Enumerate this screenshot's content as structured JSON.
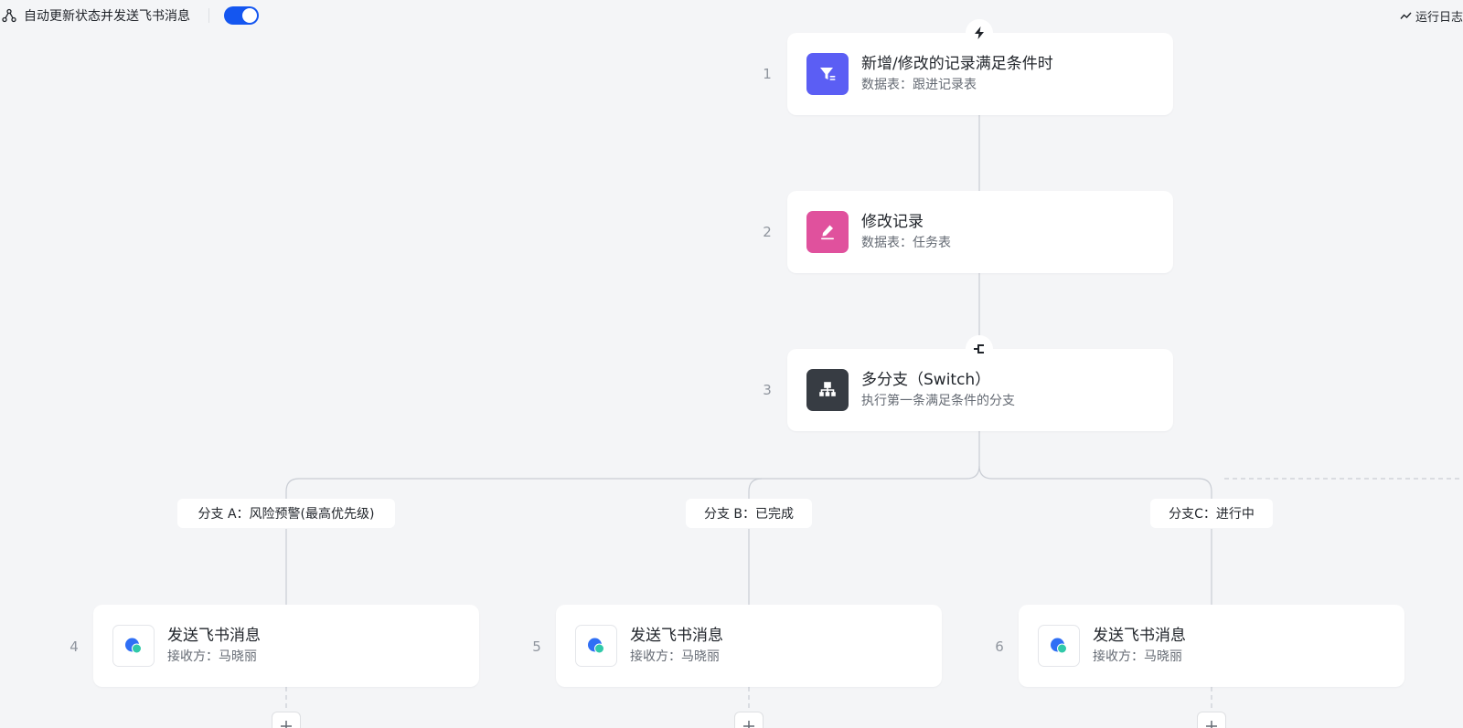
{
  "header": {
    "workflow_name": "自动更新状态并发送飞书消息",
    "enabled": true,
    "run_log_label": "运行日志"
  },
  "colors": {
    "accent": "#1456f0",
    "trigger_icon_bg": "#5b5ef4",
    "update_icon_bg": "#e0519d",
    "switch_icon_bg": "#373c43",
    "message_icon_blue": "#2f6ff5",
    "message_icon_teal": "#30c9a9"
  },
  "nodes": [
    {
      "index": "1",
      "title": "新增/修改的记录满足条件时",
      "subtitle": "数据表：跟进记录表",
      "icon": "filter-icon"
    },
    {
      "index": "2",
      "title": "修改记录",
      "subtitle": "数据表：任务表",
      "icon": "edit-icon"
    },
    {
      "index": "3",
      "title": "多分支（Switch）",
      "subtitle": "执行第一条满足条件的分支",
      "icon": "switch-icon"
    }
  ],
  "branches": [
    {
      "label": "分支 A：风险预警(最高优先级)",
      "node": {
        "index": "4",
        "title": "发送飞书消息",
        "subtitle": "接收方：马晓丽",
        "icon": "feishu-message-icon"
      }
    },
    {
      "label": "分支 B：已完成",
      "node": {
        "index": "5",
        "title": "发送飞书消息",
        "subtitle": "接收方：马晓丽",
        "icon": "feishu-message-icon"
      }
    },
    {
      "label": "分支C：进行中",
      "node": {
        "index": "6",
        "title": "发送飞书消息",
        "subtitle": "接收方：马晓丽",
        "icon": "feishu-message-icon"
      }
    }
  ]
}
